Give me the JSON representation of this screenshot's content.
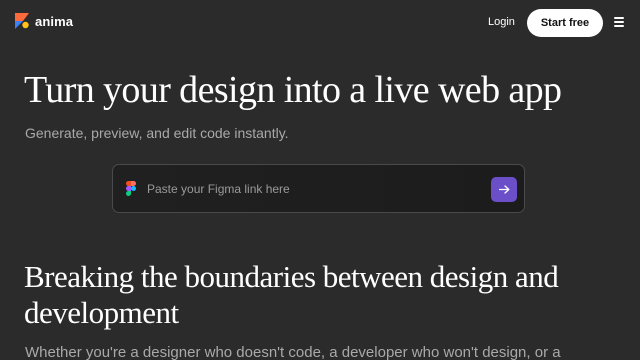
{
  "header": {
    "logo_text": "anima",
    "login_label": "Login",
    "start_free_label": "Start free",
    "menu_icon": "hamburger-menu-icon"
  },
  "hero": {
    "title": "Turn your design into a live web app",
    "subtitle": "Generate, preview, and edit code instantly.",
    "input": {
      "placeholder": "Paste your Figma link here",
      "leading_icon": "figma-icon",
      "submit_icon": "arrow-right-icon"
    }
  },
  "section": {
    "title": "Breaking the boundaries between design and development",
    "body": "Whether you're a designer who doesn't code, a developer who won't design, or a"
  },
  "colors": {
    "background": "#2b2b2b",
    "accent": "#6a4fc8",
    "muted_text": "#a9a9a9",
    "logo_orange": "#ff6a3d",
    "logo_blue": "#3b82f6",
    "logo_yellow": "#ffc21a"
  }
}
